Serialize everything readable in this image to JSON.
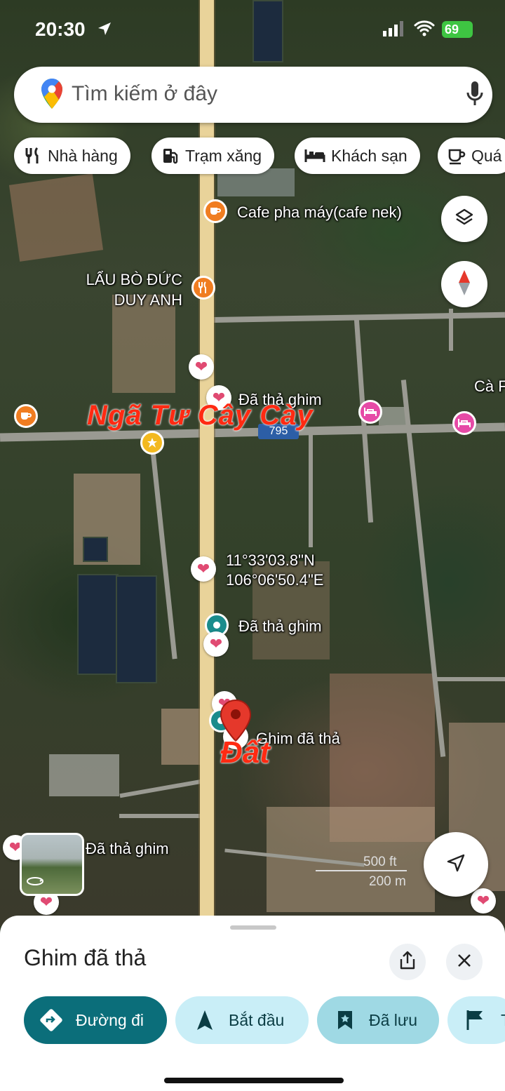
{
  "status_bar": {
    "time": "20:30",
    "battery": "69"
  },
  "search": {
    "placeholder": "Tìm kiếm ở đây"
  },
  "chips": [
    "Nhà hàng",
    "Trạm xăng",
    "Khách sạn",
    "Quá"
  ],
  "map": {
    "pois": [
      {
        "label": "Cafe pha máy(cafe nek)",
        "kind": "cafe"
      },
      {
        "label": "LẨU BÒ ĐỨC\nDUY ANH",
        "kind": "restaurant"
      }
    ],
    "pins": {
      "pin1": "Đã thả ghim",
      "pin2": "Đã thả ghim",
      "pin3": "Đã thả ghim",
      "dropped": "Ghim đã thả"
    },
    "coordinates": {
      "lat": "11°33'03.8\"N",
      "lng": "106°06'50.4\"E"
    },
    "road_number": "795",
    "edge_label": "Cà F",
    "overlay": {
      "intersection": "Ngã Tư Cây Cày",
      "land": "Đất"
    },
    "scale": {
      "feet": "500 ft",
      "meters": "200 m"
    }
  },
  "bottom_sheet": {
    "title": "Ghim đã thả",
    "actions": [
      "Đường đi",
      "Bắt đầu",
      "Đã lưu",
      "T"
    ]
  },
  "colors": {
    "primary": "#0b6e7a",
    "pin_red": "#e5382b",
    "heart": "#e04a72",
    "hotel": "#e64aa6",
    "cafe_orange": "#f07d21"
  }
}
